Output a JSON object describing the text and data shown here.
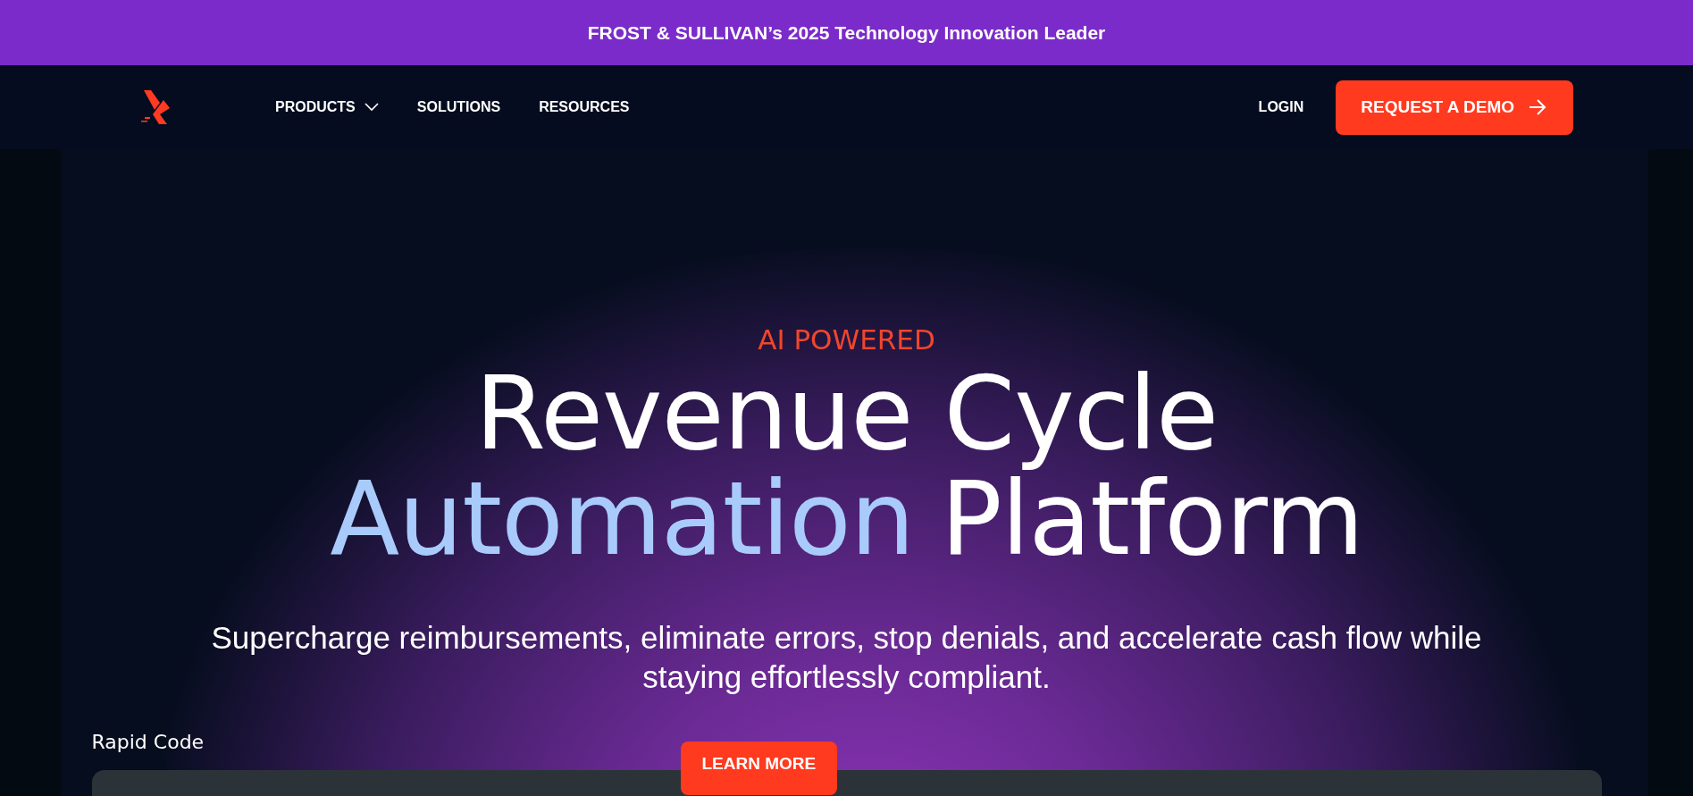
{
  "announcement": {
    "text": "FROST & SULLIVAN’s 2025 Technology Innovation Leader"
  },
  "nav": {
    "items": [
      {
        "label": "PRODUCTS",
        "has_dropdown": true
      },
      {
        "label": "SOLUTIONS",
        "has_dropdown": false
      },
      {
        "label": "RESOURCES",
        "has_dropdown": false
      }
    ],
    "login": "LOGIN",
    "cta": "REQUEST A DEMO"
  },
  "hero": {
    "eyebrow": "AI POWERED",
    "title_line_1": "Revenue Cycle",
    "title_highlight": "Automation",
    "title_rest": "Platform",
    "subtitle": "Supercharge reimbursements, eliminate errors, stop denials, and accelerate cash flow while staying effortlessly compliant."
  },
  "product": {
    "label": "Rapid Code",
    "button": "LEARN MORE"
  }
}
